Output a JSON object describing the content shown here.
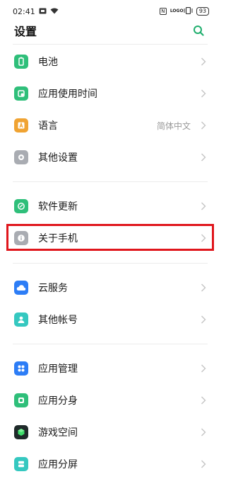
{
  "status_bar": {
    "time": "02:41",
    "nfc": "N",
    "logo": "LOGO",
    "battery": "93"
  },
  "header": {
    "title": "设置"
  },
  "colors": {
    "accent": "#1fae6d",
    "highlight": "#e0161c"
  },
  "group1": [
    {
      "label": "电池",
      "icon": "battery-icon",
      "color": "#2fbf7a"
    },
    {
      "label": "应用使用时间",
      "icon": "app-usage-icon",
      "color": "#2fbf7a"
    },
    {
      "label": "语言",
      "value": "简体中文",
      "icon": "language-icon",
      "color": "#f0a332"
    },
    {
      "label": "其他设置",
      "icon": "other-settings-icon",
      "color": "#a9acb2"
    }
  ],
  "group2": [
    {
      "label": "软件更新",
      "icon": "software-update-icon",
      "color": "#2fbf7a"
    },
    {
      "label": "关于手机",
      "icon": "info-icon",
      "color": "#a9acb2"
    }
  ],
  "group3": [
    {
      "label": "云服务",
      "icon": "cloud-icon",
      "color": "#2d7df6"
    },
    {
      "label": "其他帐号",
      "icon": "account-icon",
      "color": "#35c8c0"
    }
  ],
  "group4": [
    {
      "label": "应用管理",
      "icon": "app-management-icon",
      "color": "#2d7df6"
    },
    {
      "label": "应用分身",
      "icon": "app-clone-icon",
      "color": "#2fbf7a"
    },
    {
      "label": "游戏空间",
      "icon": "game-space-icon",
      "color": "#1f2a2a"
    },
    {
      "label": "应用分屏",
      "icon": "split-screen-icon",
      "color": "#35c8c0"
    }
  ]
}
